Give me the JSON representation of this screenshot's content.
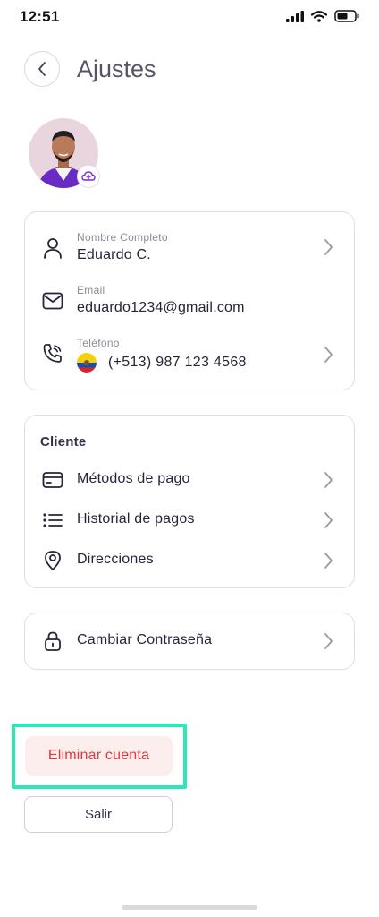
{
  "status_bar": {
    "time": "12:51"
  },
  "header": {
    "title": "Ajustes"
  },
  "profile": {
    "name_label": "Nombre Completo",
    "name_value": "Eduardo C.",
    "email_label": "Email",
    "email_value": "eduardo1234@gmail.com",
    "phone_label": "Teléfono",
    "phone_value": "(+513) 987  123 4568"
  },
  "client": {
    "title": "Cliente",
    "items": [
      {
        "label": "Métodos de pago",
        "icon": "credit-card-icon"
      },
      {
        "label": "Historial de pagos",
        "icon": "list-icon"
      },
      {
        "label": "Direcciones",
        "icon": "map-pin-icon"
      }
    ]
  },
  "security": {
    "change_password_label": "Cambiar Contraseña",
    "icon": "lock-icon"
  },
  "actions": {
    "delete_account": "Eliminar cuenta",
    "logout": "Salir"
  },
  "colors": {
    "accent": "#7b2fd0",
    "danger": "#e0383f",
    "danger_bg": "#fdeeee",
    "highlight": "#2ee6b6"
  }
}
